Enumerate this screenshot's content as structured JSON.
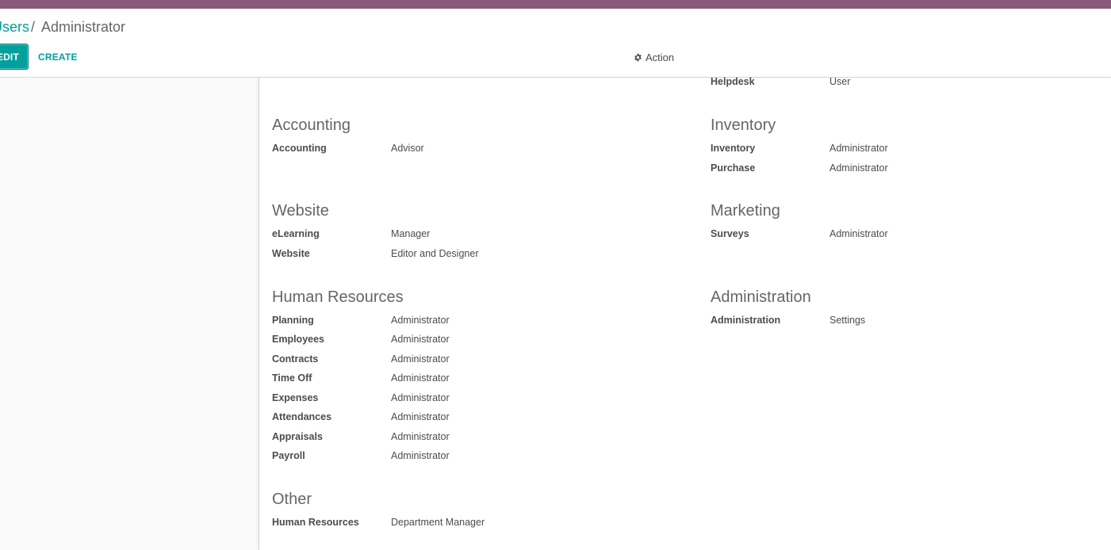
{
  "header": {
    "breadcrumb": {
      "parent": "Users",
      "separator": "/",
      "current": "Administrator"
    },
    "edit_label": "EDIT",
    "create_label": "CREATE",
    "action_label": "Action",
    "action_icon": "gear-icon"
  },
  "colors": {
    "brand_bar": "#875a7b",
    "accent": "#00a09d"
  },
  "groups": {
    "helpdesk": {
      "label": "Helpdesk",
      "value": "User"
    },
    "accounting": {
      "title": "Accounting",
      "fields": [
        {
          "label": "Accounting",
          "value": "Advisor"
        }
      ]
    },
    "inventory": {
      "title": "Inventory",
      "fields": [
        {
          "label": "Inventory",
          "value": "Administrator"
        },
        {
          "label": "Purchase",
          "value": "Administrator"
        }
      ]
    },
    "website": {
      "title": "Website",
      "fields": [
        {
          "label": "eLearning",
          "value": "Manager"
        },
        {
          "label": "Website",
          "value": "Editor and Designer"
        }
      ]
    },
    "marketing": {
      "title": "Marketing",
      "fields": [
        {
          "label": "Surveys",
          "value": "Administrator"
        }
      ]
    },
    "hr": {
      "title": "Human Resources",
      "fields": [
        {
          "label": "Planning",
          "value": "Administrator"
        },
        {
          "label": "Employees",
          "value": "Administrator"
        },
        {
          "label": "Contracts",
          "value": "Administrator"
        },
        {
          "label": "Time Off",
          "value": "Administrator"
        },
        {
          "label": "Expenses",
          "value": "Administrator"
        },
        {
          "label": "Attendances",
          "value": "Administrator"
        },
        {
          "label": "Appraisals",
          "value": "Administrator"
        },
        {
          "label": "Payroll",
          "value": "Administrator"
        }
      ]
    },
    "administration": {
      "title": "Administration",
      "fields": [
        {
          "label": "Administration",
          "value": "Settings"
        }
      ]
    },
    "other": {
      "title": "Other",
      "fields": [
        {
          "label": "Human Resources",
          "value": "Department Manager"
        }
      ]
    }
  }
}
